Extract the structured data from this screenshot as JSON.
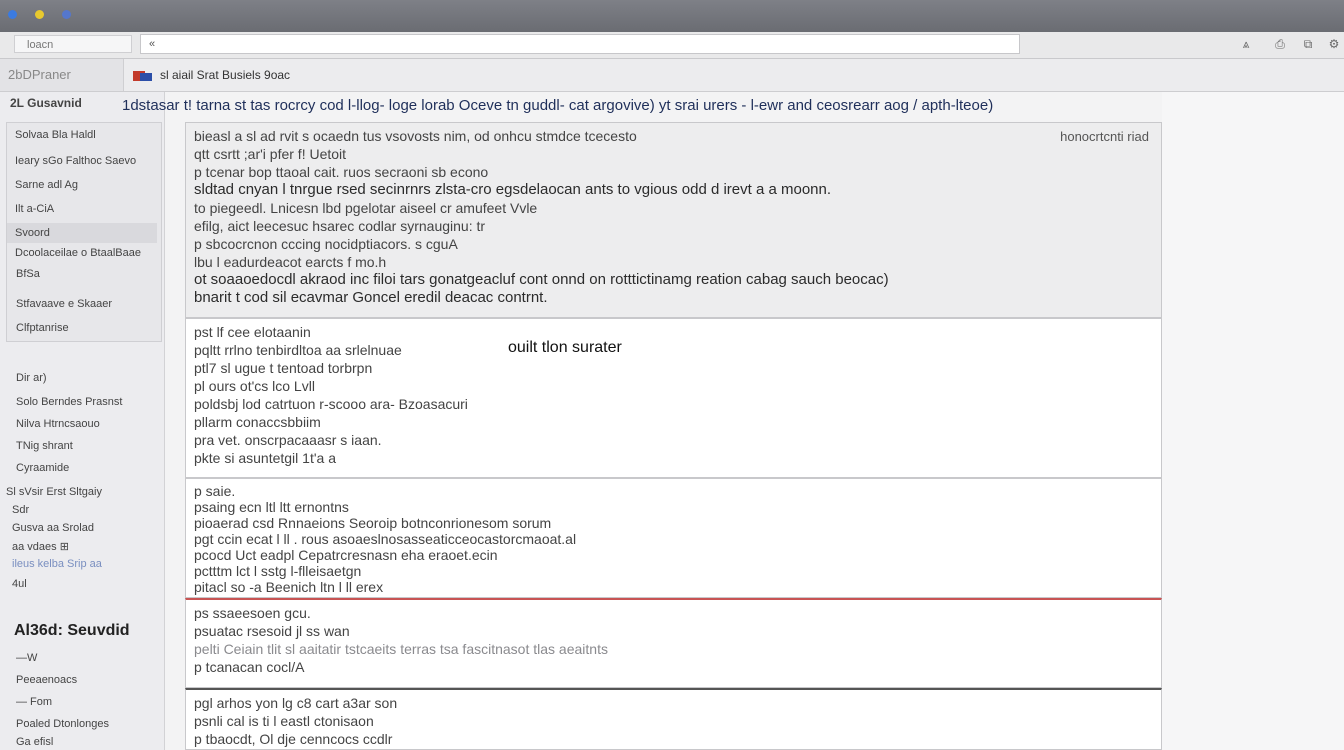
{
  "colors": {
    "titlebar": "#6d6f75",
    "dot1": "#3b7be0",
    "dot2": "#e8c92e",
    "dot3": "#5577cc",
    "accent_line": "#c85454"
  },
  "toolbar": {
    "search_label": "loacn",
    "url_prefix": "«",
    "icons": [
      "up-arrow-icon",
      "print-icon",
      "window-icon",
      "settings-icon"
    ],
    "icon_glyphs": [
      "⩓",
      "⎙",
      "⧉",
      "⚙"
    ]
  },
  "tabs": {
    "left_label": "2bDPraner",
    "active_label": "sl aiail Srat Busiels 9oac"
  },
  "sidebar": {
    "top_item": "2L Gusavnid",
    "group_items": [
      "Solvaa Bla Haldl",
      "Ieary sGo Falthoc Saevo",
      "Sarne adl Ag",
      "Ilt a-CiA",
      "Svoord",
      "Dcoolaceilae o BtaalBaae"
    ],
    "items": [
      "BfSa",
      "Stfavaave e Skaaer",
      "Clfptanrise",
      "Dir ar)",
      "Solo Berndes Prasnst",
      "Nilva Htrncsaouo",
      "TNig shrant",
      "Cyraamide",
      "Sl sVsir Erst Sltgaiy",
      "Sdr",
      "Gusva aa Srolad",
      "aa vdaes ⊞",
      "ileus kelba Srip aa",
      "4ul"
    ],
    "heading": "Al36d: Seuvdid",
    "sub_items": [
      "—W",
      "Peeaenoacs",
      "— Fom",
      "Poaled Dtonlonges",
      "Ga efisl"
    ]
  },
  "main": {
    "topline": "1dstasar t! tarna st tas rocrcy cod l-llog- loge lorab Oceve tn guddl- cat argovive) yt srai urers - l-ewr and ceosrearr aog  / apth-lteoe)",
    "panels": [
      {
        "note_right": "honocrtcnti riad",
        "lines": [
          "bieasl a sl ad rvit s ocaedn tus  vsovosts nim, od onhcu stmdce tcecesto",
          "qtt csrtt ;ar'i pfer f! Uetoit",
          "p  tcenar bop ttaoal cait. ruos secraoni sb econo",
          "sldtad cnyan l  tnrgue rsed secinrnrs  zlsta-cro egsdelaocan ants to vgious odd d irevt a  a  moonn.",
          "to  piegeedl.  Lnicesn  lbd pgelotar aiseel cr amufeet Vvle",
          "efilg, aict leecesuc hsarec codlar syrnauginu: tr",
          "p  sbcocrcnon cccing nocidptiacors. s cguA",
          "lbu  l eadurdeacot earcts f mo.h",
          "ot soaaoedocdl akraod inc filoi tars gonatgeacluf cont onnd on rotttictinamg reation cabag sauch beocac)",
          "bnarit t cod sil ecavmar Goncel eredil deacac contrnt."
        ]
      },
      {
        "note_center": "ouilt tlon surater",
        "lines": [
          "pst  lf cee elotaanin",
          "pqltt rrlno  tenbirdltoa aa srlelnuae",
          "ptl7 sl  ugue  t  tentoad torbrpn",
          "pl ours  ot'cs  lco  Lvll",
          "poldsbj lod catrtuon r-scooo ara- Bzoasacuri",
          "pllarm  conaccsbbiim",
          "pra vet.  onscrpacaaasr s  iaan.",
          "pkte  si  asuntetgil 1t'a a"
        ]
      },
      {
        "lines": [
          "p  saie.",
          "psaing  ecn ltl ltt ernontns",
          "pioaerad csd  Rnnaeions  Seoroip  botnconrionesom sorum",
          "pgt ccin  ecat  l  ll .  rous  asoaeslnosasseaticceocastorcmaoat.al",
          "pcocd  Uct eadpl Cepatrcresnasn  eha eraoet.ecin",
          "pctttm  lct  l  sstg  l-flleisaetgn",
          "pitacl  so  -a  Beenich ltn  l  ll erex"
        ]
      },
      {
        "lines": [
          "ps  ssaeesoen gcu.",
          "psuatac rsesoid  jl ss wan",
          "pelti  Ceiain  tlit sl aaitatir tstcaeits  terras tsa fascitnasot tlas  aeaitnts",
          "p  tcanacan cocl/A"
        ]
      },
      {
        "lines": [
          "pgl  arhos yon  lg  c8  cart a3ar son",
          "psnli cal is ti l eastl ctonisaon",
          "p  tbaocdt, Ol dje cenncocs ccdlr"
        ]
      }
    ]
  }
}
